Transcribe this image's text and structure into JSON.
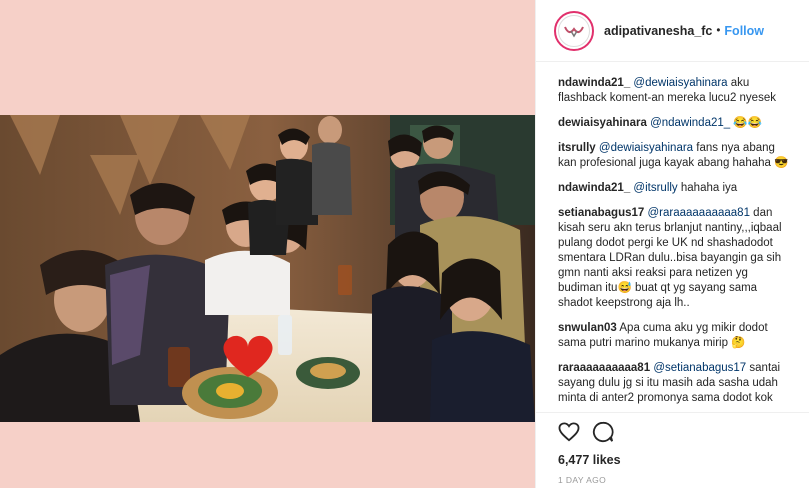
{
  "post": {
    "username": "adipativanesha_fc",
    "separator": "•",
    "follow_label": "Follow",
    "likes": "6,477 likes",
    "time": "1 DAY AGO"
  },
  "colors": {
    "media_background": "#f6d0c8",
    "link": "#3897f0",
    "mention": "#003569",
    "heart": "#e0271f"
  },
  "icons": {
    "like": "heart-outline-icon",
    "comment": "speech-bubble-icon"
  },
  "comments": [
    {
      "user": "ndawinda21_",
      "mention": "@dewiaisyahinara",
      "text": " aku flashback koment-an mereka lucu2 nyesek"
    },
    {
      "user": "dewiaisyahinara",
      "mention": "@ndawinda21_",
      "text": " 😂😂"
    },
    {
      "user": "itsrully",
      "mention": "@dewiaisyahinara",
      "text": " fans nya abang kan profesional juga kayak abang hahaha 😎"
    },
    {
      "user": "ndawinda21_",
      "mention": "@itsrully",
      "text": " hahaha iya"
    },
    {
      "user": "setianabagus17",
      "mention": "@raraaaaaaaaaa81",
      "text": " dan kisah seru akn terus brlanjut nantiny,,,iqbaal pulang dodot pergi ke UK nd shashadodot smentara LDRan dulu..bisa bayangin ga sih gmn nanti aksi reaksi para netizen yg budiman itu😅 buat qt yg sayang sama shadot keepstrong aja lh.."
    },
    {
      "user": "snwulan03",
      "mention": "",
      "text": " Apa cuma aku yg mikir dodot sama putri marino mukanya mirip 🤔"
    },
    {
      "user": "raraaaaaaaaaa81",
      "mention": "@setianabagus17",
      "text": " santai sayang dulu jg si itu masih ada sasha udah minta di anter2 promonya sama dodot kok"
    }
  ]
}
